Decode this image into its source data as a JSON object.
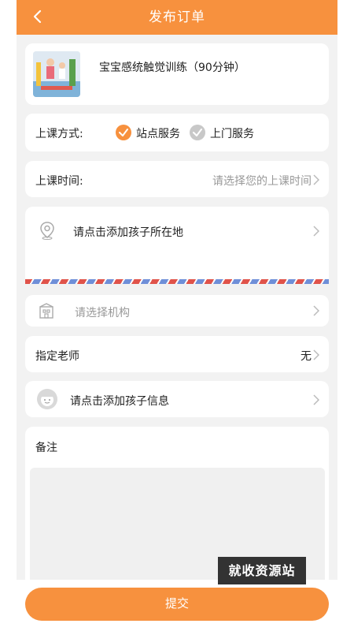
{
  "header": {
    "title": "发布订单"
  },
  "product": {
    "name": "宝宝感统触觉训练（90分钟）"
  },
  "class_mode": {
    "label": "上课方式:",
    "options": [
      {
        "label": "站点服务",
        "selected": true
      },
      {
        "label": "上门服务",
        "selected": false
      }
    ]
  },
  "class_time": {
    "label": "上课时间:",
    "placeholder": "请选择您的上课时间"
  },
  "location": {
    "prompt": "请点击添加孩子所在地"
  },
  "institution": {
    "placeholder": "请选择机构"
  },
  "teacher": {
    "label": "指定老师",
    "value": "无"
  },
  "child_info": {
    "prompt": "请点击添加孩子信息"
  },
  "remarks": {
    "label": "备注"
  },
  "watermark": {
    "text": "就收资源站"
  },
  "submit": {
    "label": "提交"
  },
  "colors": {
    "accent": "#f7913e",
    "unselected": "#c8c8c8",
    "background": "#f2f2f2"
  }
}
